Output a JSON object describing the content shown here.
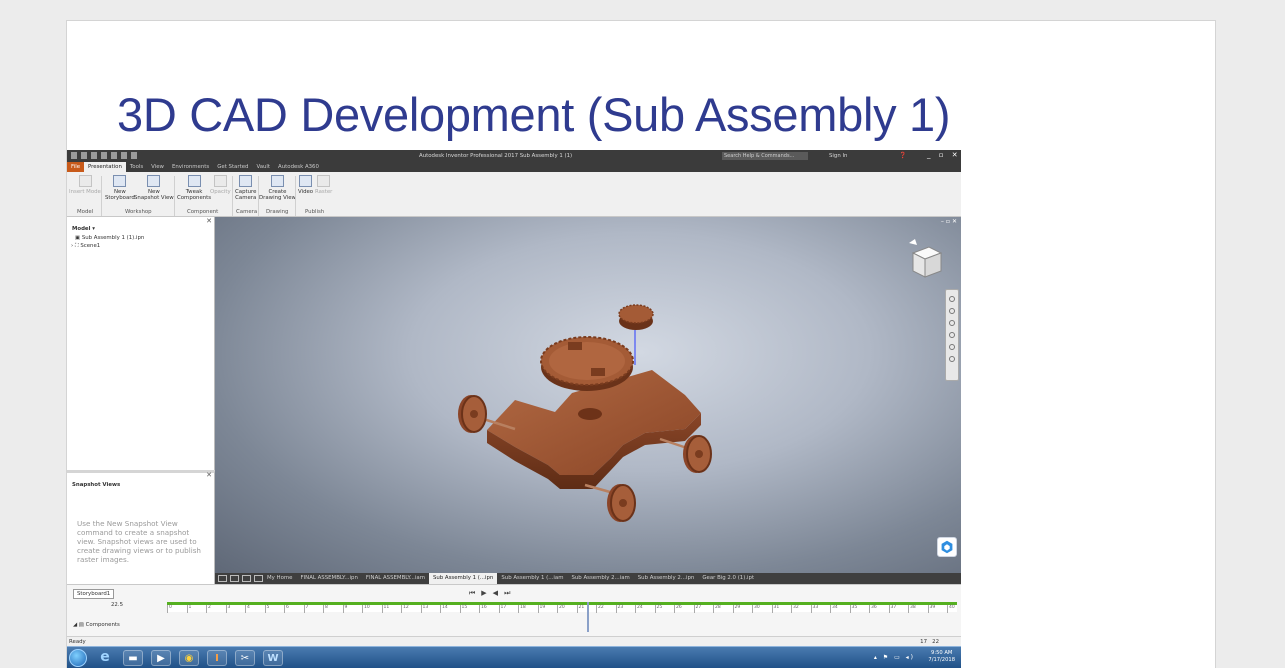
{
  "slide": {
    "title": "3D CAD Development (Sub Assembly 1)"
  },
  "app": {
    "window_title": "Autodesk Inventor Professional 2017   Sub Assembly 1 (1)",
    "search_placeholder": "Search Help & Commands...",
    "sign_in": "Sign In",
    "menu_tabs": [
      "File",
      "Presentation",
      "Tools",
      "View",
      "Environments",
      "Get Started",
      "Vault",
      "Autodesk A360"
    ],
    "active_tab": "Presentation"
  },
  "ribbon": {
    "buttons": [
      {
        "label1": "Insert Model",
        "label2": "",
        "enabled": false
      },
      {
        "label1": "New",
        "label2": "Storyboard",
        "enabled": true
      },
      {
        "label1": "New",
        "label2": "Snapshot View",
        "enabled": true
      },
      {
        "label1": "Tweak",
        "label2": "Components",
        "enabled": true
      },
      {
        "label1": "Opacity",
        "label2": "",
        "enabled": false
      },
      {
        "label1": "Capture",
        "label2": "Camera",
        "enabled": true
      },
      {
        "label1": "Create",
        "label2": "Drawing View",
        "enabled": true
      },
      {
        "label1": "Video",
        "label2": "",
        "enabled": true
      },
      {
        "label1": "Raster",
        "label2": "",
        "enabled": false
      }
    ],
    "groups": [
      "Model",
      "Workshop",
      "Component",
      "Camera",
      "Drawing",
      "Publish"
    ]
  },
  "browser": {
    "header": "Model ▾",
    "items": [
      "Sub Assembly 1 (1).ipn",
      "Scene1"
    ]
  },
  "snapshot": {
    "header": "Snapshot Views",
    "message": "Use the New Snapshot View command to create a snapshot view. Snapshot views are used to create drawing views or to publish raster images."
  },
  "doc_tabs": [
    {
      "label": "My Home",
      "active": false
    },
    {
      "label": "FINAL ASSEMBLY...ipn",
      "active": false
    },
    {
      "label": "FINAL ASSEMBLY...iam",
      "active": false
    },
    {
      "label": "Sub Assembly 1 (...ipn",
      "active": true
    },
    {
      "label": "Sub Assembly 1 (...iam",
      "active": false
    },
    {
      "label": "Sub Assembly 2...iam",
      "active": false
    },
    {
      "label": "Sub Assembly 2...ipn",
      "active": false
    },
    {
      "label": "Gear Big 2.0 (1).ipt",
      "active": false
    }
  ],
  "storyboard": {
    "tab": "Storyboard1",
    "time": "22.5",
    "component_row": "Components",
    "ticks": [
      "0",
      "1",
      "2",
      "3",
      "4",
      "5",
      "6",
      "7",
      "8",
      "9",
      "10",
      "11",
      "12",
      "13",
      "14",
      "15",
      "16",
      "17",
      "18",
      "19",
      "20",
      "21",
      "22",
      "23",
      "24",
      "25",
      "26",
      "27",
      "28",
      "29",
      "30",
      "31",
      "32",
      "33",
      "34",
      "35",
      "36",
      "37",
      "38",
      "39",
      "40"
    ]
  },
  "status": {
    "left": "Ready",
    "right_a": "17",
    "right_b": "22"
  },
  "taskbar": {
    "time": "9:50 AM",
    "date": "7/17/2018"
  },
  "colors": {
    "title": "#2f3b8f",
    "wood": "#a0522d",
    "file_tab": "#c85a1a",
    "timeline": "#55b020"
  }
}
